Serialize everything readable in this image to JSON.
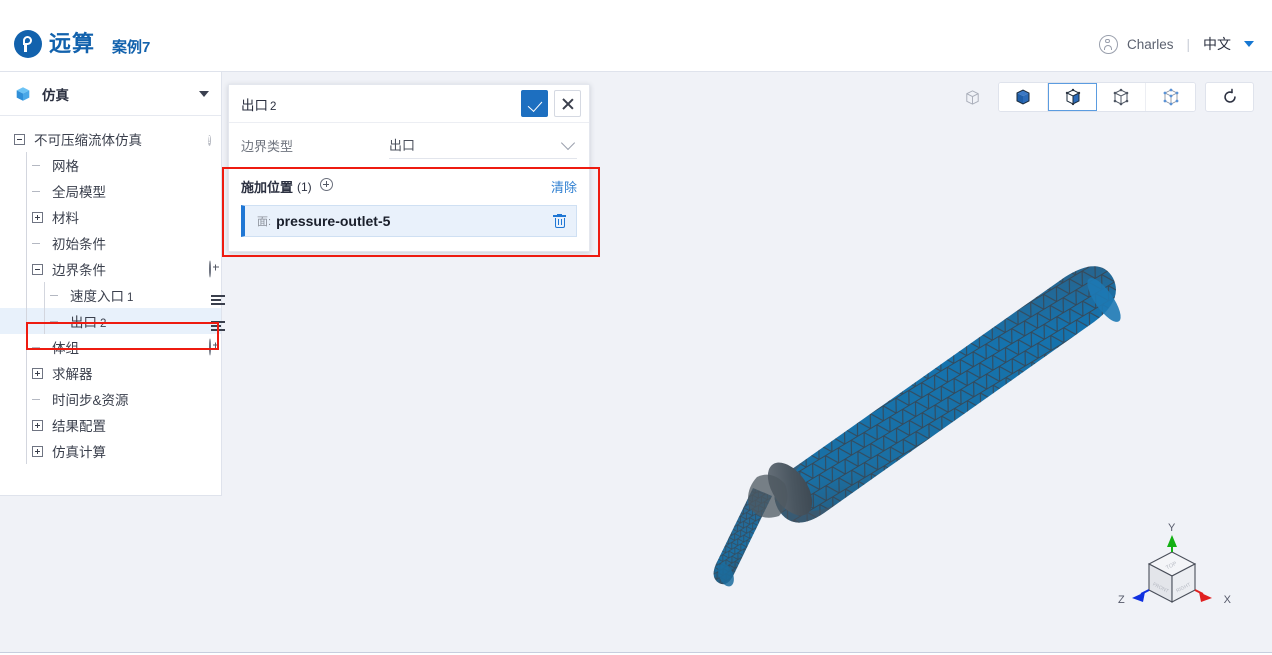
{
  "app": {
    "brand_name": "远算",
    "project_name": "案例7",
    "logo_icon": "circular-logo-icon"
  },
  "topbar": {
    "user_icon": "user-avatar-icon",
    "user_name": "Charles",
    "divider": "|",
    "language": "中文",
    "caret_icon": "caret-down-icon"
  },
  "tree": {
    "header": {
      "icon": "blue-cube-icon",
      "title": "仿真",
      "caret_icon": "caret-down-icon"
    },
    "items": [
      {
        "label": "不可压缩流体仿真",
        "depth": 0,
        "toggle": "minus",
        "right_icon": "info-icon",
        "selected": false
      },
      {
        "label": "网格",
        "depth": 1,
        "toggle": "branch",
        "right_icon": "",
        "selected": false
      },
      {
        "label": "全局模型",
        "depth": 1,
        "toggle": "branch",
        "right_icon": "",
        "selected": false
      },
      {
        "label": "材料",
        "depth": 1,
        "toggle": "plus",
        "right_icon": "",
        "selected": false
      },
      {
        "label": "初始条件",
        "depth": 1,
        "toggle": "branch",
        "right_icon": "",
        "selected": false
      },
      {
        "label": "边界条件",
        "depth": 1,
        "toggle": "minus",
        "right_icon": "plus-circle-icon",
        "selected": false
      },
      {
        "label": "速度入口",
        "num": "1",
        "depth": 2,
        "toggle": "branch",
        "right_icon": "list-icon",
        "selected": false
      },
      {
        "label": "出口",
        "num": "2",
        "depth": 2,
        "toggle": "branch",
        "right_icon": "list-icon",
        "selected": true
      },
      {
        "label": "体组",
        "depth": 1,
        "toggle": "branch",
        "right_icon": "plus-circle-icon",
        "selected": false
      },
      {
        "label": "求解器",
        "depth": 1,
        "toggle": "plus",
        "right_icon": "",
        "selected": false
      },
      {
        "label": "时间步&资源",
        "depth": 1,
        "toggle": "branch",
        "right_icon": "",
        "selected": false
      },
      {
        "label": "结果配置",
        "depth": 1,
        "toggle": "plus",
        "right_icon": "",
        "selected": false
      },
      {
        "label": "仿真计算",
        "depth": 1,
        "toggle": "plus",
        "right_icon": "",
        "selected": false
      }
    ]
  },
  "panel": {
    "title": "出口",
    "title_num": "2",
    "confirm_icon": "check-icon",
    "cancel_icon": "close-icon",
    "type_label": "边界类型",
    "type_value": "出口",
    "type_chevron_icon": "chevron-down-icon",
    "location_label": "施加位置",
    "location_count": "(1)",
    "location_add_icon": "plus-circle-icon",
    "clear_label": "清除",
    "location_items": [
      {
        "prefix": "面:",
        "name": "pressure-outlet-5",
        "delete_icon": "trash-icon"
      }
    ]
  },
  "toolbar": {
    "ghost_icon": "wireframe-cube-icon",
    "buttons": [
      {
        "icon": "solid-cube-icon",
        "active": false
      },
      {
        "icon": "solid-with-edges-cube-icon",
        "active": true
      },
      {
        "icon": "wireframe-cube-icon",
        "active": false
      },
      {
        "icon": "points-cube-icon",
        "active": false
      }
    ],
    "reset_icon": "reset-view-icon"
  },
  "axis_gizmo": {
    "x_label": "X",
    "y_label": "Y",
    "z_label": "Z",
    "x_color": "#e02020",
    "y_color": "#13b013",
    "z_color": "#1030e0",
    "face_front": "FRONT",
    "face_right": "RIGHT",
    "face_top": "TOP"
  },
  "colors": {
    "brand": "#1262ad",
    "accent": "#1d6fc0",
    "annotation": "#ee1b10",
    "viewport_bg": "#f0f2f7",
    "selection_bg": "#e8f1fb",
    "mesh_fill": "#1a6ea8",
    "mesh_edge": "#3c4450"
  }
}
